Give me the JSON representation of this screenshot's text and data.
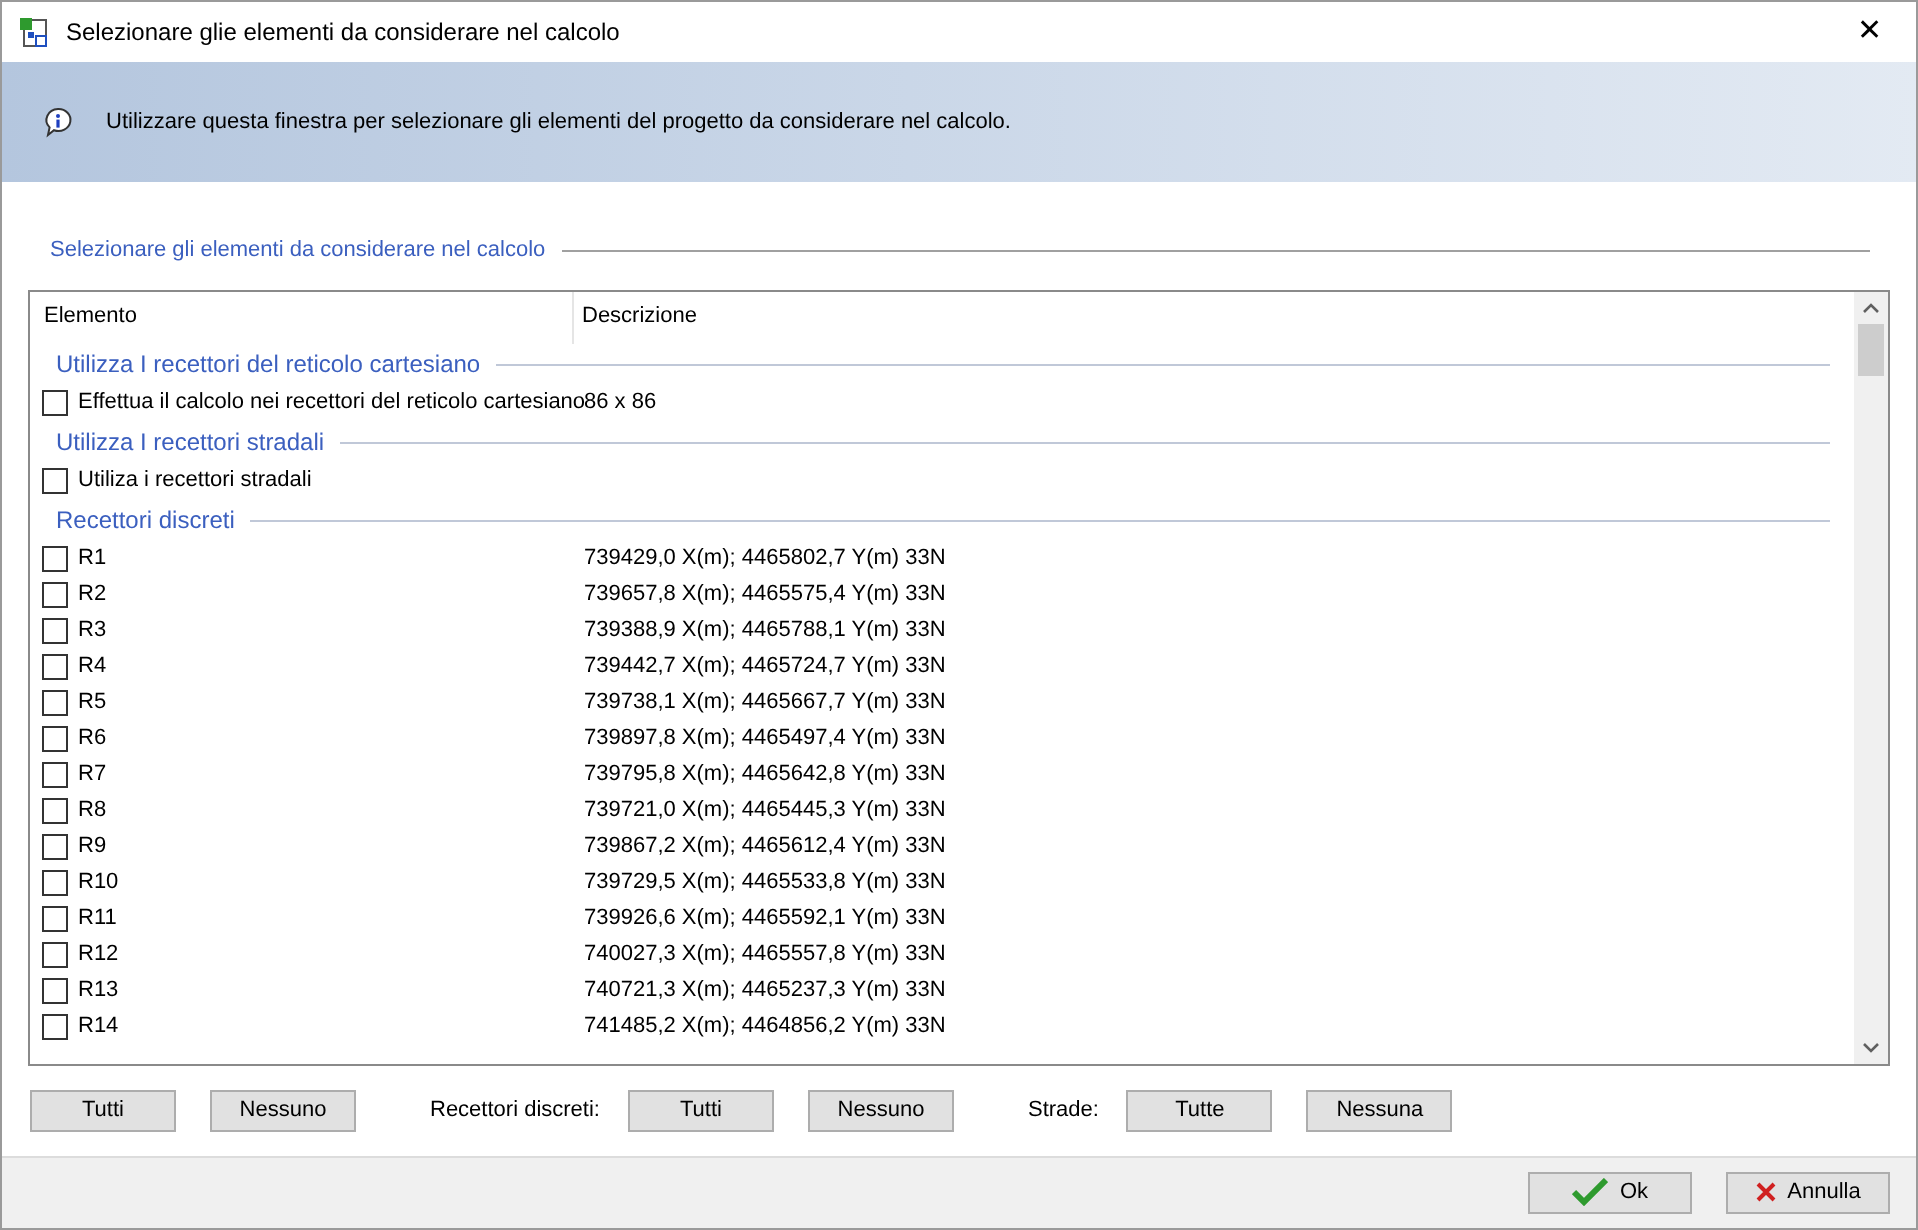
{
  "window": {
    "title": "Selezionare glie elementi da considerare nel calcolo",
    "close": "✕"
  },
  "banner": {
    "text": "Utilizzare questa finestra per selezionare gli elementi del progetto da considerare nel calcolo."
  },
  "group_title": "Selezionare gli elementi da considerare nel calcolo",
  "table": {
    "columns": [
      "Elemento",
      "Descrizione"
    ],
    "sections": [
      {
        "title": "Utilizza I recettori del reticolo cartesiano",
        "rows": [
          {
            "element": "Effettua il calcolo nei recettori del reticolo cartesiano",
            "description": "86 x 86",
            "checked": false
          }
        ]
      },
      {
        "title": "Utilizza I recettori stradali",
        "rows": [
          {
            "element": "Utiliza i recettori stradali",
            "description": "",
            "checked": false
          }
        ]
      },
      {
        "title": "Recettori discreti",
        "rows": [
          {
            "element": "R1",
            "description": "739429,0 X(m); 4465802,7 Y(m) 33N",
            "checked": false
          },
          {
            "element": "R2",
            "description": "739657,8 X(m); 4465575,4 Y(m) 33N",
            "checked": false
          },
          {
            "element": "R3",
            "description": "739388,9 X(m); 4465788,1 Y(m) 33N",
            "checked": false
          },
          {
            "element": "R4",
            "description": "739442,7 X(m); 4465724,7 Y(m) 33N",
            "checked": false
          },
          {
            "element": "R5",
            "description": "739738,1 X(m); 4465667,7 Y(m) 33N",
            "checked": false
          },
          {
            "element": "R6",
            "description": "739897,8 X(m); 4465497,4 Y(m) 33N",
            "checked": false
          },
          {
            "element": "R7",
            "description": "739795,8 X(m); 4465642,8 Y(m) 33N",
            "checked": false
          },
          {
            "element": "R8",
            "description": "739721,0 X(m); 4465445,3 Y(m) 33N",
            "checked": false
          },
          {
            "element": "R9",
            "description": "739867,2 X(m); 4465612,4 Y(m) 33N",
            "checked": false
          },
          {
            "element": "R10",
            "description": "739729,5 X(m); 4465533,8 Y(m) 33N",
            "checked": false
          },
          {
            "element": "R11",
            "description": "739926,6 X(m); 4465592,1 Y(m) 33N",
            "checked": false
          },
          {
            "element": "R12",
            "description": "740027,3 X(m); 4465557,8 Y(m) 33N",
            "checked": false
          },
          {
            "element": "R13",
            "description": "740721,3 X(m); 4465237,3 Y(m) 33N",
            "checked": false
          },
          {
            "element": "R14",
            "description": "741485,2 X(m); 4464856,2 Y(m) 33N",
            "checked": false
          }
        ]
      }
    ]
  },
  "selection_buttons": [
    {
      "kind": "button",
      "text": "Tutti"
    },
    {
      "kind": "button",
      "text": "Nessuno"
    },
    {
      "kind": "label",
      "text": "Recettori discreti:"
    },
    {
      "kind": "button",
      "text": "Tutti"
    },
    {
      "kind": "button",
      "text": "Nessuno"
    },
    {
      "kind": "label",
      "text": "Strade:"
    },
    {
      "kind": "button",
      "text": "Tutte"
    },
    {
      "kind": "button",
      "text": "Nessuna"
    }
  ],
  "footer_buttons": [
    {
      "kind": "ok",
      "text": "Ok"
    },
    {
      "kind": "cancel",
      "text": "Annulla"
    }
  ]
}
